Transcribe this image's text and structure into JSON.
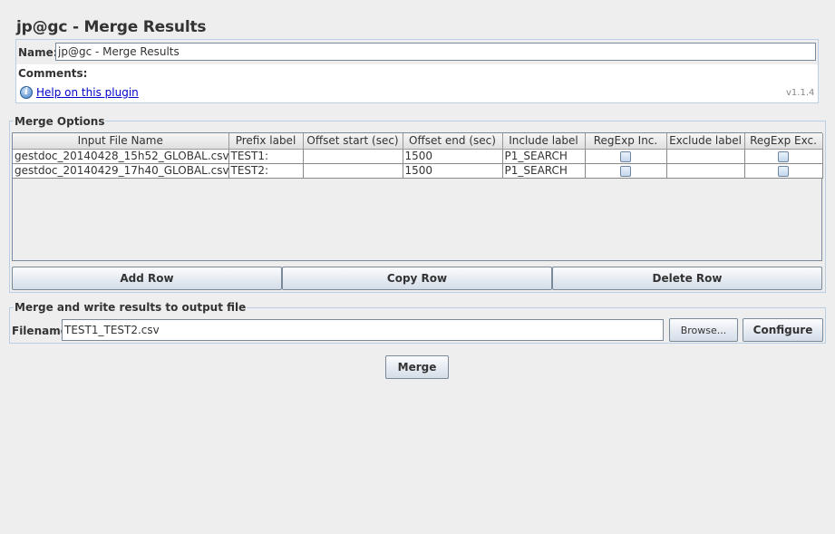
{
  "page": {
    "title": "jp@gc - Merge Results"
  },
  "name_panel": {
    "name_label": "Name:",
    "name_value": "jp@gc - Merge Results",
    "comments_label": "Comments:",
    "help_link": "Help on this plugin",
    "version": "v1.1.4",
    "help_icon": "info-icon"
  },
  "merge_options": {
    "title": "Merge Options",
    "columns": [
      "Input File Name",
      "Prefix label",
      "Offset start (sec)",
      "Offset end (sec)",
      "Include label",
      "RegExp Inc.",
      "Exclude label",
      "RegExp Exc."
    ],
    "rows": [
      {
        "file": "gestdoc_20140428_15h52_GLOBAL.csv",
        "prefix": "TEST1:",
        "offset_start": "",
        "offset_end": "1500",
        "include": "P1_SEARCH",
        "regexp_inc": false,
        "exclude": "",
        "regexp_exc": false
      },
      {
        "file": "gestdoc_20140429_17h40_GLOBAL.csv",
        "prefix": "TEST2:",
        "offset_start": "",
        "offset_end": "1500",
        "include": "P1_SEARCH",
        "regexp_inc": false,
        "exclude": "",
        "regexp_exc": false
      }
    ],
    "add_row": "Add Row",
    "copy_row": "Copy Row",
    "delete_row": "Delete Row"
  },
  "output": {
    "title": "Merge and write results to output file",
    "filename_label": "Filename",
    "filename_value": "TEST1_TEST2.csv",
    "browse": "Browse...",
    "configure": "Configure"
  },
  "merge_button": "Merge"
}
